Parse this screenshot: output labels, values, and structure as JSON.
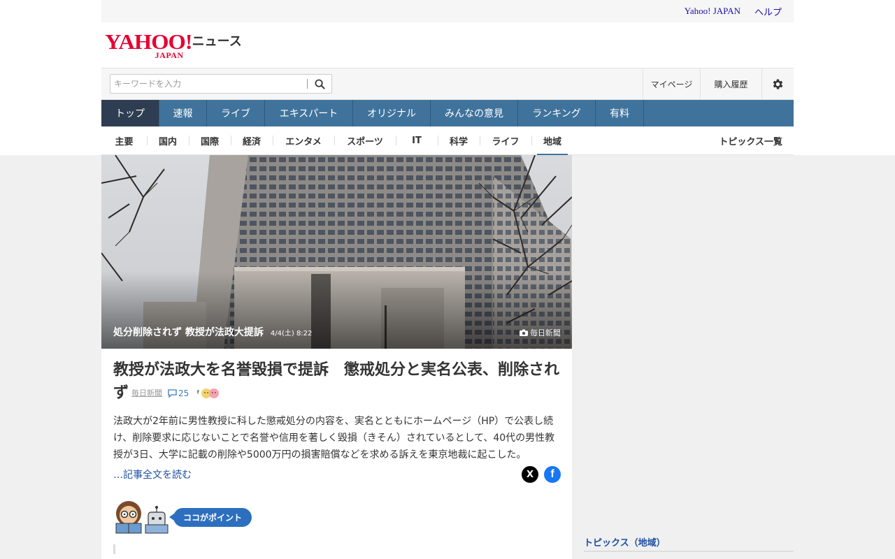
{
  "util": {
    "yahoo_japan": "Yahoo! JAPAN",
    "help": "ヘルプ"
  },
  "logo": {
    "main": "YAHOO!",
    "sub": "JAPAN",
    "service": "ニュース"
  },
  "search": {
    "placeholder": "キーワードを入力",
    "icon": "search-icon"
  },
  "header_right": {
    "mypage": "マイページ",
    "purchase_history": "購入履歴",
    "settings_icon": "gear-icon"
  },
  "main_nav": [
    {
      "label": "トップ"
    },
    {
      "label": "速報"
    },
    {
      "label": "ライブ"
    },
    {
      "label": "エキスパート"
    },
    {
      "label": "オリジナル"
    },
    {
      "label": "みんなの意見"
    },
    {
      "label": "ランキング"
    },
    {
      "label": "有料"
    }
  ],
  "sub_nav": [
    {
      "label": "主要"
    },
    {
      "label": "国内"
    },
    {
      "label": "国際"
    },
    {
      "label": "経済"
    },
    {
      "label": "エンタメ"
    },
    {
      "label": "スポーツ"
    },
    {
      "label": "IT"
    },
    {
      "label": "科学"
    },
    {
      "label": "ライフ"
    },
    {
      "label": "地域"
    }
  ],
  "sub_nav_active": "地域",
  "topics_list": "トピックス一覧",
  "hero": {
    "caption": "処分削除されず 教授が法政大提訴",
    "date": "4/4(土) 8:22",
    "source": "毎日新聞"
  },
  "article": {
    "headline": "教授が法政大を名誉毀損で提訴　懲戒処分と実名公表、削除されず",
    "source": "毎日新聞",
    "comment_count": "25",
    "lead": "法政大が2年前に男性教授に科した懲戒処分の内容を、実名とともにホームページ（HP）で公表し続け、削除要求に応じないことで名誉や信用を著しく毀損（きそん）されているとして、40代の男性教授が3日、大学に記載の削除や5000万円の損害賠償などを求める訴えを東京地裁に起こした。",
    "read_more": "…記事全文を読む",
    "share_x": "X",
    "share_facebook": "f"
  },
  "point": {
    "label": "ココがポイント"
  },
  "sidebar": {
    "topics_region": "トピックス（地域）"
  },
  "colors": {
    "nav_blue": "#40739b",
    "nav_active": "#2e3d52",
    "brand_red": "#e60033",
    "link_blue": "#1d4fa5",
    "pill_blue": "#2d6fbf"
  }
}
